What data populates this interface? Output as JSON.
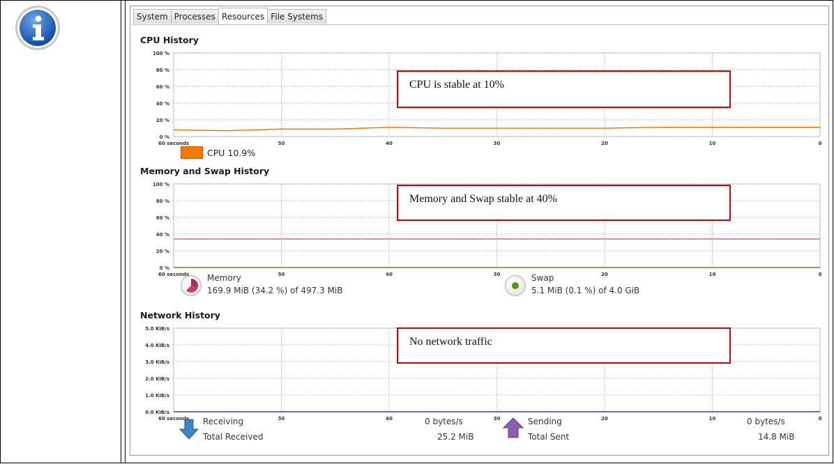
{
  "tabs": [
    "System",
    "Processes",
    "Resources",
    "File Systems"
  ],
  "active_tab": "Resources",
  "sections": {
    "cpu": {
      "title": "CPU History",
      "y_ticks": [
        "100 %",
        "80 %",
        "60 %",
        "40 %",
        "20 %",
        "0 %"
      ],
      "x_ticks": [
        "60 seconds",
        "50",
        "40",
        "30",
        "20",
        "10",
        "0"
      ],
      "legend": "CPU 10.9%",
      "annotation": "CPU is stable at 10%"
    },
    "memory": {
      "title": "Memory and Swap History",
      "y_ticks": [
        "100 %",
        "80 %",
        "60 %",
        "40 %",
        "20 %",
        "0 %"
      ],
      "x_ticks": [
        "60 seconds",
        "50",
        "40",
        "30",
        "20",
        "10",
        "0"
      ],
      "memory_label": "Memory",
      "memory_value": "169.9 MiB (34.2 %) of 497.3 MiB",
      "swap_label": "Swap",
      "swap_value": "5.1 MiB (0.1 %) of 4.0 GiB",
      "annotation": "Memory and Swap stable at 40%"
    },
    "network": {
      "title": "Network History",
      "y_ticks": [
        "5.0 KiB/s",
        "4.0 KiB/s",
        "3.0 KiB/s",
        "2.0 KiB/s",
        "1.0 KiB/s",
        "0.0 KiB/s"
      ],
      "x_ticks": [
        "60 seconds",
        "50",
        "40",
        "30",
        "20",
        "10",
        "0"
      ],
      "receiving_label": "Receiving",
      "receiving_rate": "0 bytes/s",
      "total_received_label": "Total Received",
      "total_received": "25.2 MiB",
      "sending_label": "Sending",
      "sending_rate": "0 bytes/s",
      "total_sent_label": "Total Sent",
      "total_sent": "14.8 MiB",
      "annotation": "No network traffic"
    }
  },
  "chart_data": [
    {
      "type": "line",
      "x": [
        60,
        55,
        50,
        45,
        40,
        35,
        30,
        25,
        20,
        15,
        10,
        5,
        0
      ],
      "series": [
        {
          "name": "CPU",
          "values": [
            8,
            7,
            9,
            9,
            11,
            10,
            10,
            10,
            10,
            11,
            11,
            11,
            11
          ],
          "color": "#f57900"
        }
      ],
      "ylim": [
        0,
        100
      ],
      "xlim": [
        60,
        0
      ]
    },
    {
      "type": "line",
      "x": [
        60,
        0
      ],
      "series": [
        {
          "name": "Memory",
          "values": [
            34.2,
            34.2
          ],
          "color": "#d9668f"
        },
        {
          "name": "Swap",
          "values": [
            0.1,
            0.1
          ],
          "color": "#4e9a06"
        }
      ],
      "ylim": [
        0,
        100
      ],
      "xlim": [
        60,
        0
      ]
    },
    {
      "type": "line",
      "x": [
        60,
        0
      ],
      "series": [
        {
          "name": "Receiving",
          "values": [
            0,
            0
          ],
          "color": "#3465a4"
        },
        {
          "name": "Sending",
          "values": [
            0,
            0
          ],
          "color": "#75507b"
        }
      ],
      "ylim": [
        0,
        5
      ],
      "xlim": [
        60,
        0
      ]
    }
  ],
  "colors": {
    "annotation_border": "#d50000",
    "cpu": "#f57900",
    "memory": "#d9668f",
    "swap": "#4e9a06"
  }
}
